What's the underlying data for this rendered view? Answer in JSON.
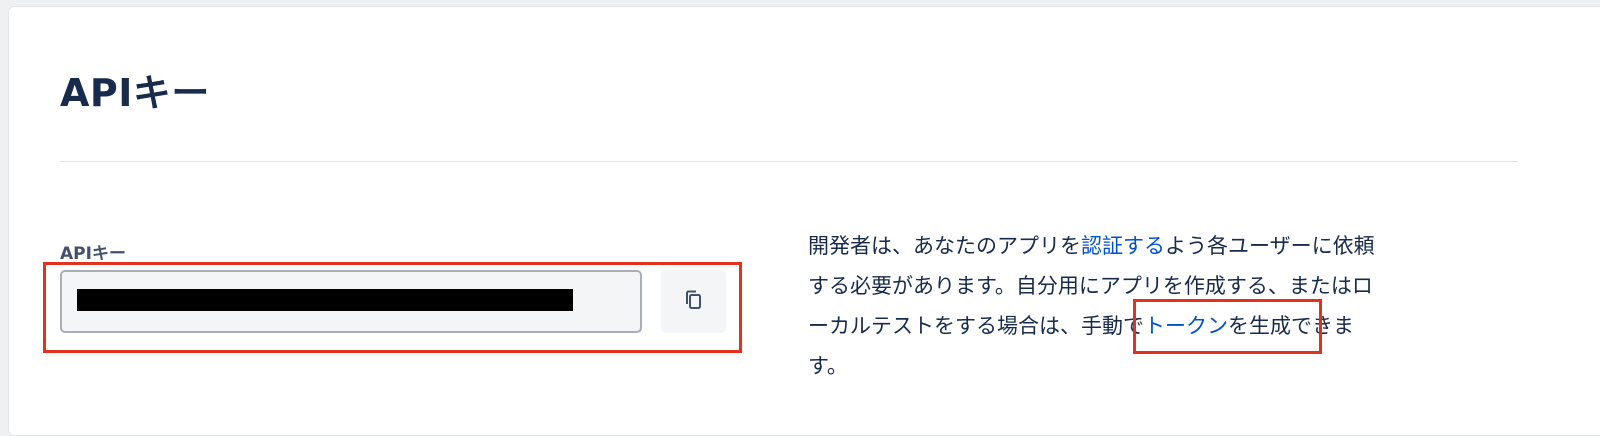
{
  "header": {
    "title": "APIキー"
  },
  "api_key": {
    "label": "APIキー",
    "value": "",
    "copy_icon": "copy-icon"
  },
  "description": {
    "line1_before": "開発者は、あなたのアプリを",
    "link_authenticate": "認証する",
    "line1_after": "よう各ユーザーに依頼",
    "line2": "する必要があります。自分用にアプリを作成する、またはロ",
    "line3_before": "ーカルテストをする場合は、",
    "manual": "手動で",
    "link_token": "トークン",
    "line3_after": "を生成できま",
    "line4": "す。"
  },
  "colors": {
    "title": "#172b4d",
    "link": "#0052cc",
    "highlight": "#e2321d"
  }
}
